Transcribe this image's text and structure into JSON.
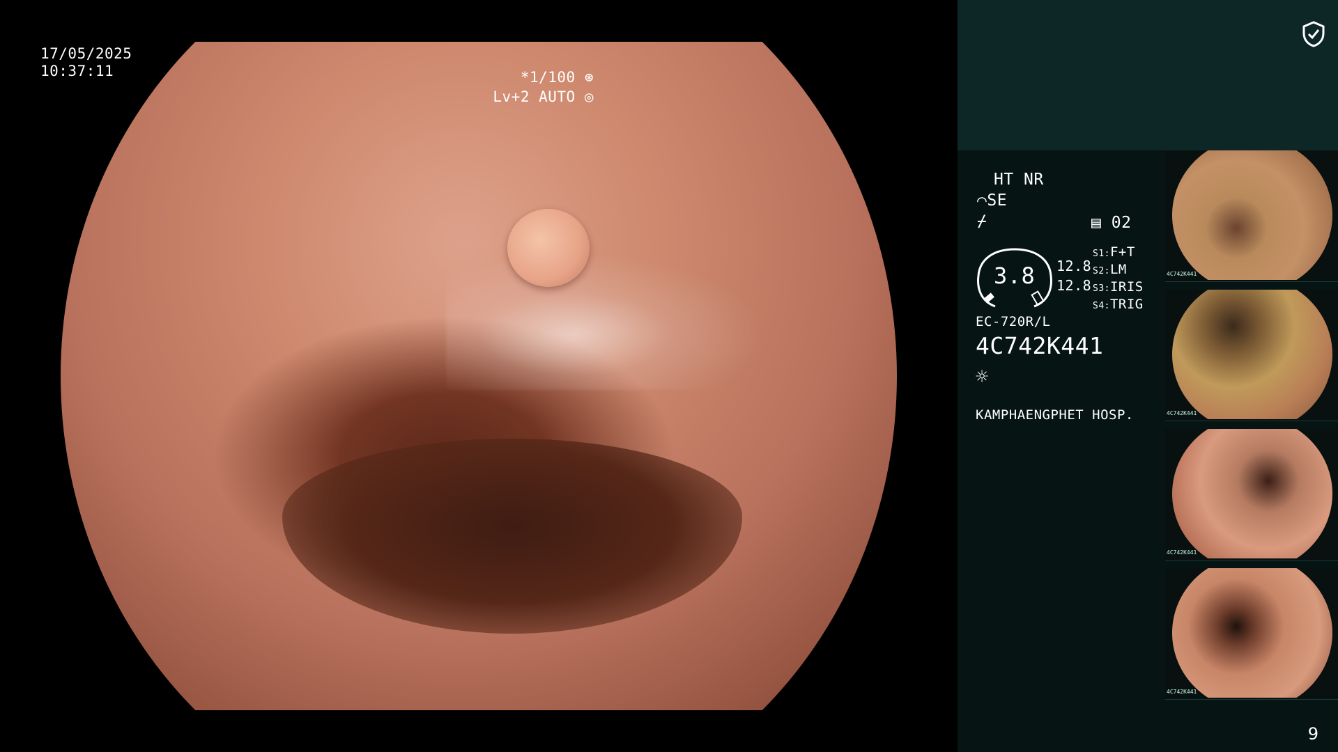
{
  "overlay": {
    "date": "17/05/2025",
    "time": "10:37:11",
    "shutter": "*1/100",
    "level": "Lv+2 AUTO"
  },
  "info_panel": {
    "mode1": "HT NR",
    "mode2": "SE",
    "record_count": "02",
    "gauge_value": "3.8",
    "value_top": "12.8",
    "value_bottom": "12.8",
    "s1": "F+T",
    "s2": "LM",
    "s3": "IRIS",
    "s4": "TRIG",
    "s1_label": "S1:",
    "s2_label": "S2:",
    "s3_label": "S3:",
    "s4_label": "S4:",
    "scope_model": "EC-720R/L",
    "scope_serial": "4C742K441",
    "hospital": "KAMPHAENGPHET HOSP."
  },
  "thumbnails": [
    {
      "label": "4C742K441"
    },
    {
      "label": "4C742K441"
    },
    {
      "label": "4C742K441"
    },
    {
      "label": "4C742K441"
    }
  ],
  "page_number": "9",
  "colors": {
    "accent_orange": "#f2a93b",
    "panel_dark": "#061414",
    "panel_top": "#0d2727"
  }
}
